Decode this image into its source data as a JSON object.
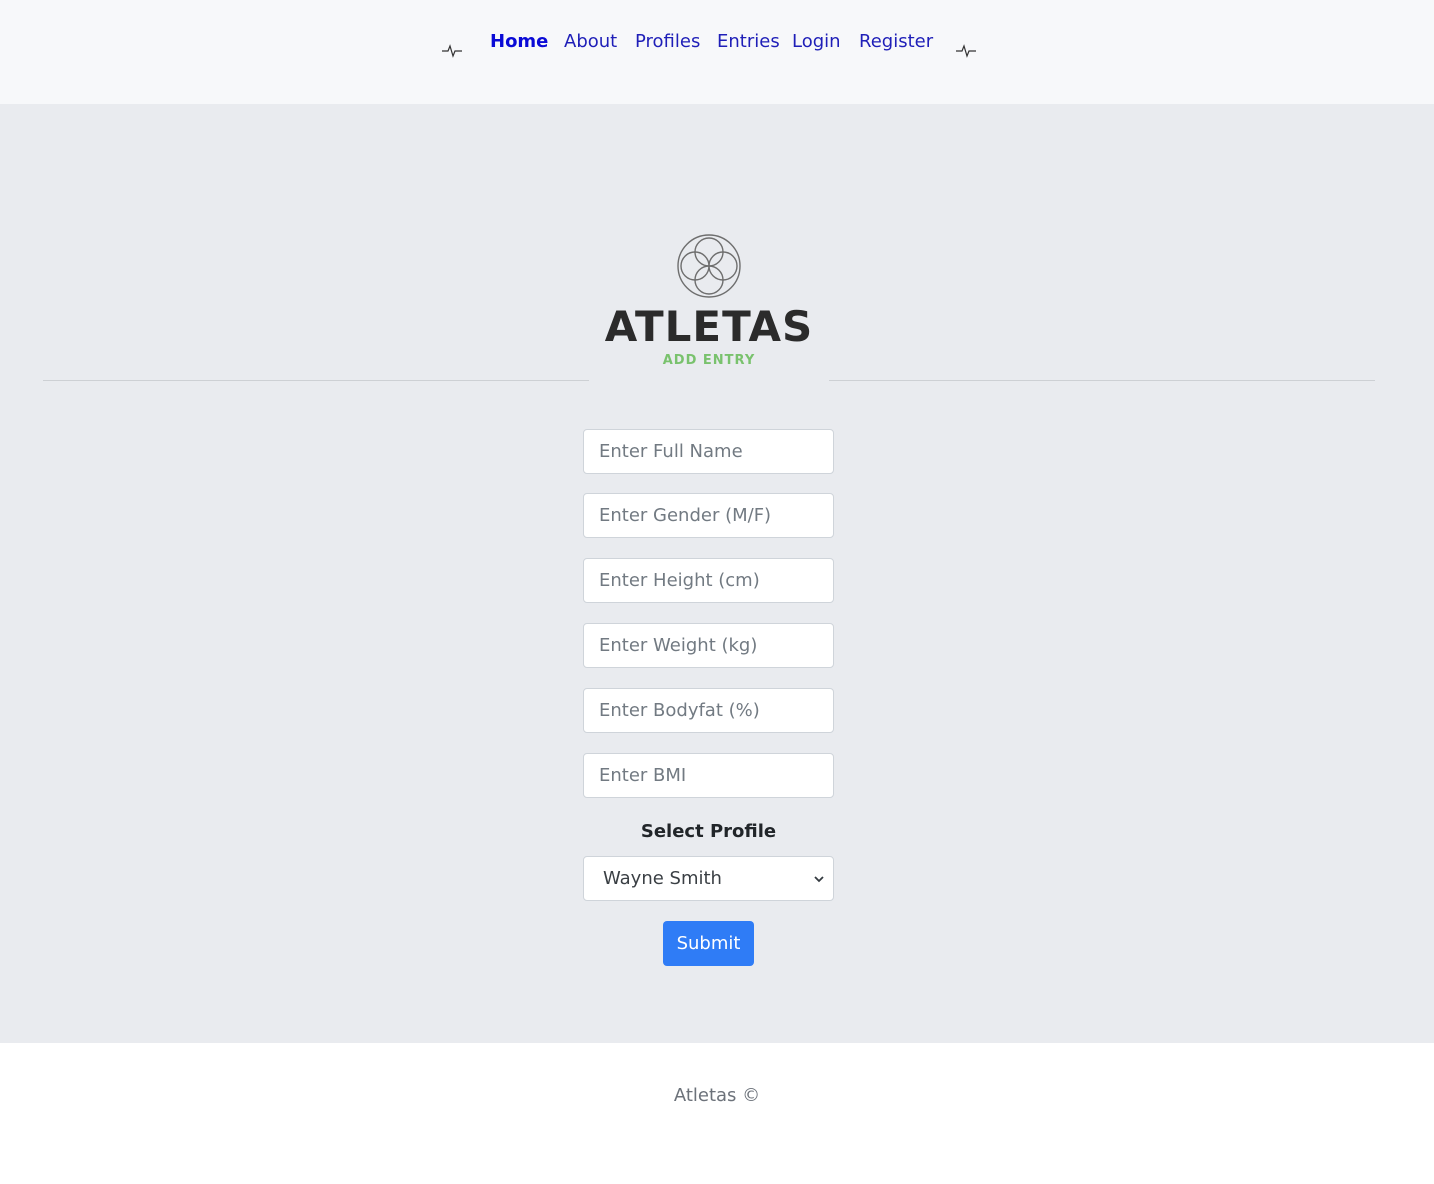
{
  "nav": {
    "links": [
      {
        "label": "Home",
        "active": true
      },
      {
        "label": "About"
      },
      {
        "label": "Profiles"
      },
      {
        "label": "Entries"
      },
      {
        "label": "Login"
      },
      {
        "label": "Register"
      }
    ],
    "left_icon": "heartbeat-icon",
    "right_icon": "heartbeat-icon"
  },
  "logo": {
    "emblem_icon": "interlocking-circles-icon",
    "title": "ATLETAS",
    "subtitle": "ADD ENTRY",
    "subtitle_color": "#79c26d"
  },
  "form": {
    "fields": [
      {
        "placeholder": "Enter Full Name",
        "value": ""
      },
      {
        "placeholder": "Enter Gender (M/F)",
        "value": ""
      },
      {
        "placeholder": "Enter Height (cm)",
        "value": ""
      },
      {
        "placeholder": "Enter Weight (kg)",
        "value": ""
      },
      {
        "placeholder": "Enter Bodyfat (%)",
        "value": ""
      },
      {
        "placeholder": "Enter BMI",
        "value": ""
      }
    ],
    "select_label": "Select Profile",
    "select_value": "Wayne Smith",
    "submit_label": "Submit",
    "submit_color": "#2f7cf6"
  },
  "footer": {
    "text": "Atletas ©"
  }
}
